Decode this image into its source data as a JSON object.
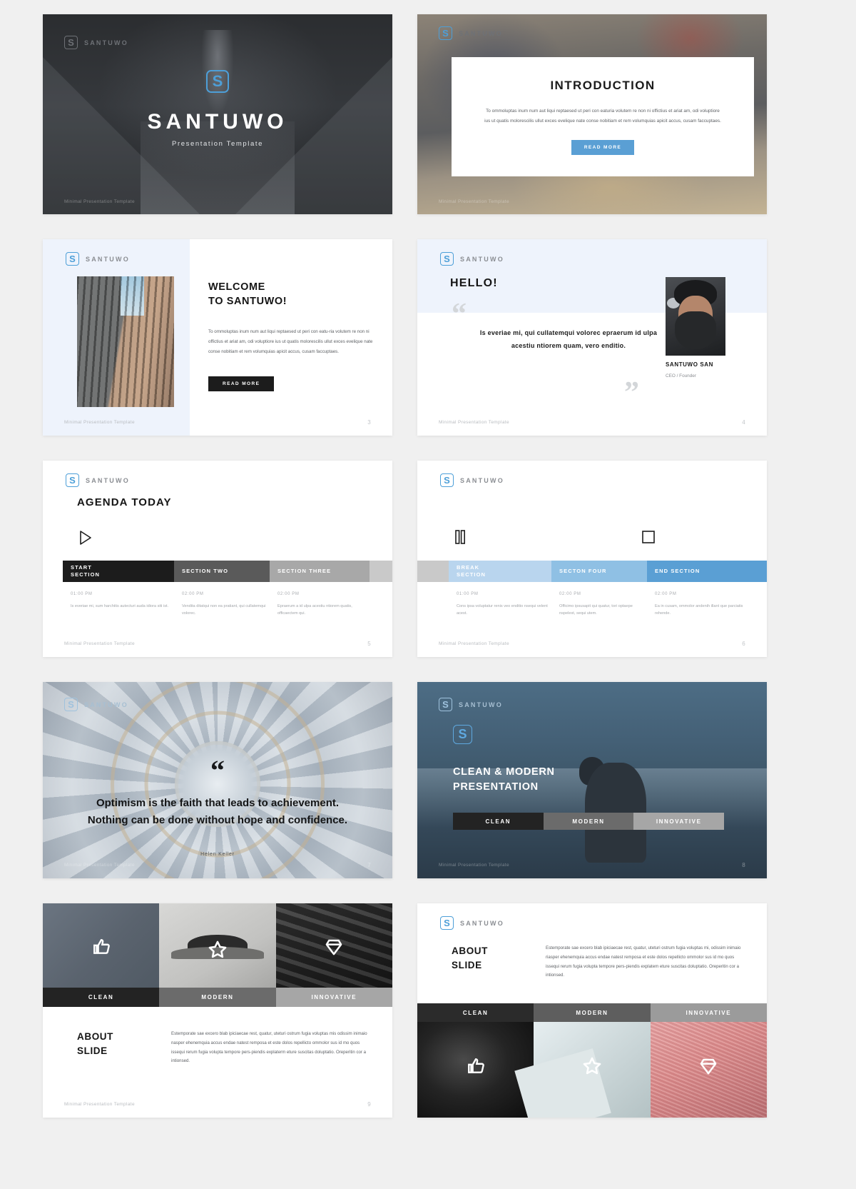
{
  "brand": {
    "name": "SANTUWO",
    "logo_icon": "santuwo-s-logo",
    "accent": "#4d9fd8"
  },
  "footer_label": "Minimal Presentation Template",
  "slides": [
    {
      "id": "cover",
      "title": "SANTUWO",
      "subtitle": "Presentation  Template"
    },
    {
      "id": "introduction",
      "title": "INTRODUCTION",
      "body": "To ommoluptas inum num aut liqui reptaesed ut peri con eaturia volutem re non ni offictius et ariat am, odi voluptiore ius ut quatis molorescilis ullut exces evelique nate conse nobitiam et rem volumquias apicit accus, cusam faccuptaes.",
      "button": "READ MORE",
      "button_color": "#5a9fd4"
    },
    {
      "id": "welcome",
      "title_line1": "WELCOME",
      "title_line2": "TO SANTUWO!",
      "body": "To ommoluptas inum num aut liqui reptaesed ut peri con eatu-ria volutem re non ni offictius et ariat am, odi voluptiore ius ut quatis molorescilis ullut exces evelique nate conse nobitiam et rem volumquias apicit accus, cusam faccuptaes.",
      "button": "READ MORE",
      "button_color": "#1c1c1c",
      "page": "3"
    },
    {
      "id": "hello",
      "title": "HELLO!",
      "quote": "Is everiae mi, qui cullatemqui volorec epraerum id ulpa acestiu ntiorem quam, vero enditio.",
      "person_name": "SANTUWO SAN",
      "person_role": "CEO / Founder",
      "page": "4"
    },
    {
      "id": "agenda-today",
      "title": "AGENDA TODAY",
      "control_icon": "play-icon",
      "columns": [
        {
          "label": "START\nSECTION",
          "time": "01:00 PM",
          "desc": "Is everiae mi, sum harchitis autecturi auda idiora siti ist.",
          "color": "#1c1c1c"
        },
        {
          "label": "SECTION TWO",
          "time": "02:00 PM",
          "desc": "Vendita ditatqui non ea pratiant, qui cullatemqui volorec.",
          "color": "#5a5a5a"
        },
        {
          "label": "SECTION THREE",
          "time": "02:00 PM",
          "desc": "Epraerum a id ulpa acestiu ntiorem quatis, officaectem qui.",
          "color": "#a8a8a8"
        }
      ],
      "page": "5"
    },
    {
      "id": "agenda-break",
      "control_icons": [
        "pause-icon",
        "stop-icon"
      ],
      "columns": [
        {
          "label": "BREAK\nSECTION",
          "time": "01:00 PM",
          "desc": "Cons ipsa voluptatur renis veo enditio nsequi velent acest.",
          "color": "#b9d5ee"
        },
        {
          "label": "SECTON FOUR",
          "time": "02:00 PM",
          "desc": "Officimo ipsusapit qui quatur, tori optaepe nspelest, sequi utem.",
          "color": "#8fc0e4"
        },
        {
          "label": "END SECTION",
          "time": "02:00 PM",
          "desc": "Ea in cusam, ommolor andenih illant que parciatis rehende.",
          "color": "#5a9fd4"
        }
      ],
      "page": "6"
    },
    {
      "id": "quote",
      "quote": "Optimism is the faith that leads to achievement. Nothing can be done without hope and confidence.",
      "author": "Helen  Keller",
      "page": "7"
    },
    {
      "id": "clean-modern",
      "title_line1": "CLEAN & MODERN",
      "title_line2": "PRESENTATION",
      "tiles": [
        {
          "label": "CLEAN",
          "color": "#232323"
        },
        {
          "label": "MODERN",
          "color": "#6b6b6b"
        },
        {
          "label": "INNOVATIVE",
          "color": "#a6a6a6"
        }
      ],
      "page": "8"
    },
    {
      "id": "about-slide-icons",
      "title_line1": "ABOUT",
      "title_line2": "SLIDE",
      "body": "Estemporate sae excero blab ipiciaecae rest, quatur, uteturi ostrum fugia voluptas mis odissim inimaio nasper ehenemquia accus endae natest remposa et este dolos repellicto ommolor sus id mo quos issequi rerum fugia volupta tempore pers-piendis explaterm eture suscitas doluptatio. Oreperitin cor a intionsed.",
      "tiles": [
        {
          "label": "CLEAN",
          "color": "#232323",
          "icon": "thumbs-up-icon"
        },
        {
          "label": "MODERN",
          "color": "#6b6b6b",
          "icon": "star-icon"
        },
        {
          "label": "INNOVATIVE",
          "color": "#a6a6a6",
          "icon": "diamond-icon"
        }
      ],
      "page": "9"
    },
    {
      "id": "about-slide-photos",
      "title_line1": "ABOUT",
      "title_line2": "SLIDE",
      "body": "Estemporate sae excero blab ipiciaecae rest, quatur, uteturi ostrum fugia voluptas mi, odissim inimaio riasper ehenemquia accus endae natest remposa et este dolos repellicto ommolor sus id mo quos issequi rerum fugia volupta tempore pers-piendis explatem eture suscitas doluptatio. Oreperitin cor a intionsed.",
      "tiles": [
        {
          "label": "CLEAN",
          "color": "#2b2b2b",
          "icon": "thumbs-up-icon"
        },
        {
          "label": "MODERN",
          "color": "#5e5e5e",
          "icon": "star-icon"
        },
        {
          "label": "INNOVATIVE",
          "color": "#9b9b9b",
          "icon": "diamond-icon"
        }
      ]
    }
  ]
}
